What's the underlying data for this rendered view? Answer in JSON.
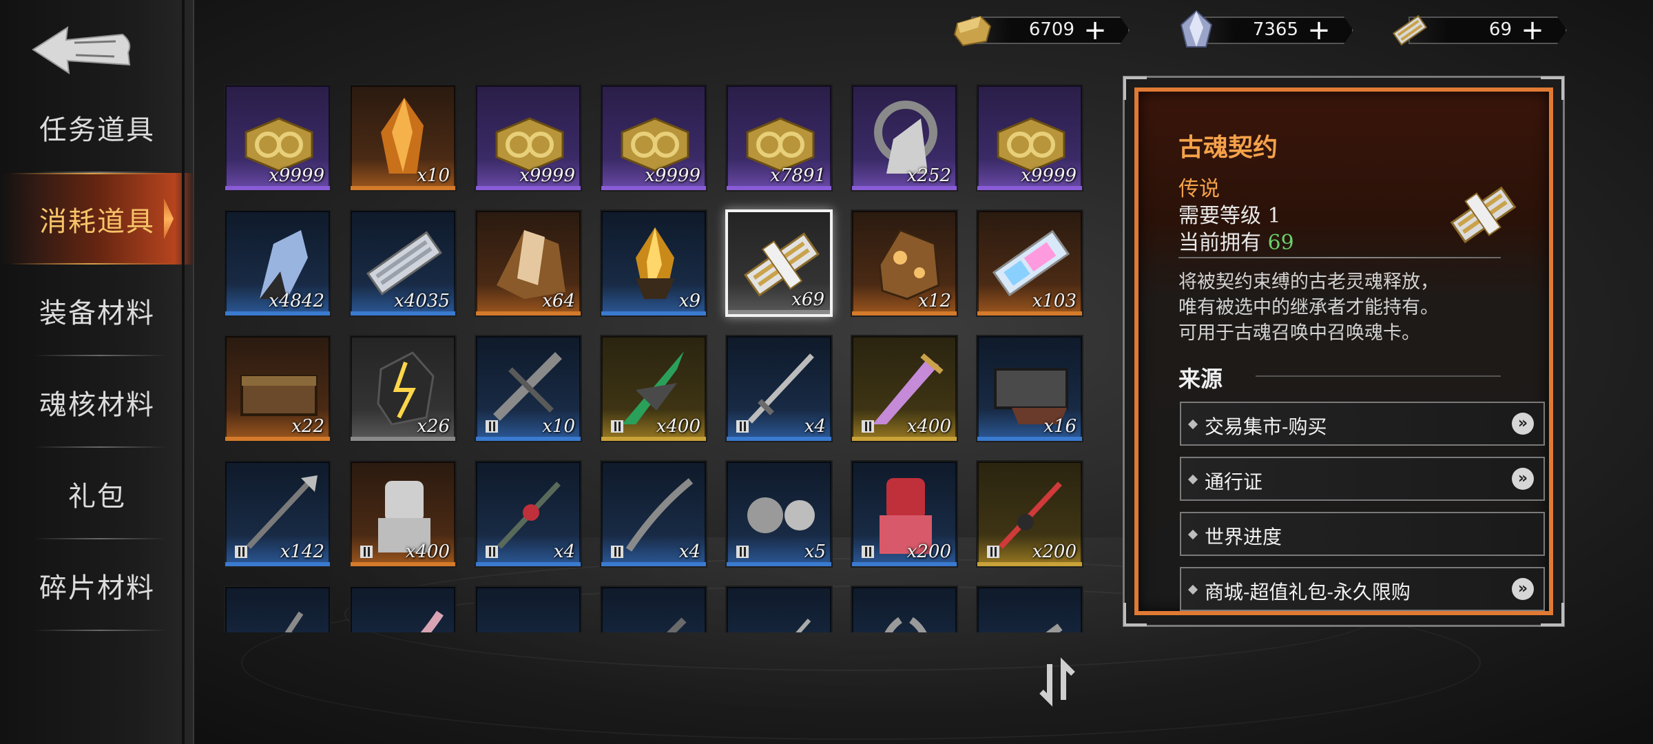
{
  "sidebar": {
    "items": [
      {
        "label": "任务道具",
        "active": false
      },
      {
        "label": "消耗道具",
        "active": true
      },
      {
        "label": "装备材料",
        "active": false
      },
      {
        "label": "魂核材料",
        "active": false
      },
      {
        "label": "礼包",
        "active": false
      },
      {
        "label": "碎片材料",
        "active": false
      }
    ]
  },
  "currency": [
    {
      "icon": "gold-ingot-icon",
      "value": "6709"
    },
    {
      "icon": "crystal-icon",
      "value": "7365"
    },
    {
      "icon": "soul-contract-icon",
      "value": "69"
    }
  ],
  "grid": {
    "rows": [
      [
        {
          "icon": "gold-chest-icon",
          "rarity": "purple",
          "count": "x9999"
        },
        {
          "icon": "amber-shard-icon",
          "rarity": "orange",
          "count": "x10"
        },
        {
          "icon": "gold-chest-icon",
          "rarity": "purple",
          "count": "x9999"
        },
        {
          "icon": "gold-chest-icon",
          "rarity": "purple",
          "count": "x9999"
        },
        {
          "icon": "gold-chest-icon",
          "rarity": "purple",
          "count": "x7891"
        },
        {
          "icon": "silver-ring-icon",
          "rarity": "purple",
          "count": "x252"
        },
        {
          "icon": "gold-chest-icon",
          "rarity": "purple",
          "count": "x9999"
        }
      ],
      [
        {
          "icon": "blue-crystal-icon",
          "rarity": "blue",
          "count": "x4842"
        },
        {
          "icon": "silver-contract-icon",
          "rarity": "blue",
          "count": "x4035"
        },
        {
          "icon": "brown-crystal-icon",
          "rarity": "orange",
          "count": "x64"
        },
        {
          "icon": "gold-crystal-icon",
          "rarity": "blue",
          "count": "x9"
        },
        {
          "icon": "soul-contract-icon",
          "rarity": "gray",
          "count": "x69",
          "selected": true
        },
        {
          "icon": "ore-icon",
          "rarity": "orange",
          "count": "x12"
        },
        {
          "icon": "prism-contract-icon",
          "rarity": "orange",
          "count": "x103"
        }
      ],
      [
        {
          "icon": "chest-icon",
          "rarity": "orange",
          "count": "x22"
        },
        {
          "icon": "lightning-stone-icon",
          "rarity": "gray",
          "count": "x26"
        },
        {
          "icon": "crossbow-icon",
          "rarity": "blue",
          "count": "x10",
          "locked": true
        },
        {
          "icon": "green-blade-icon",
          "rarity": "gold",
          "count": "x400",
          "locked": true
        },
        {
          "icon": "sword-icon",
          "rarity": "blue",
          "count": "x4",
          "locked": true
        },
        {
          "icon": "greatsword-icon",
          "rarity": "gold",
          "count": "x400",
          "locked": true
        },
        {
          "icon": "mimic-chest-icon",
          "rarity": "blue",
          "count": "x16"
        }
      ],
      [
        {
          "icon": "spear-icon",
          "rarity": "blue",
          "count": "x142",
          "locked": true
        },
        {
          "icon": "armor-icon",
          "rarity": "orange",
          "count": "x400",
          "locked": true
        },
        {
          "icon": "rose-spear-icon",
          "rarity": "blue",
          "count": "x4",
          "locked": true
        },
        {
          "icon": "scythe-icon",
          "rarity": "blue",
          "count": "x4",
          "locked": true
        },
        {
          "icon": "gauntlet-icon",
          "rarity": "blue",
          "count": "x5",
          "locked": true
        },
        {
          "icon": "red-armor-icon",
          "rarity": "blue",
          "count": "x200",
          "locked": true
        },
        {
          "icon": "red-staff-icon",
          "rarity": "gold",
          "count": "x200",
          "locked": true
        }
      ],
      [
        {
          "icon": "axe-icon",
          "rarity": "blue",
          "count": ""
        },
        {
          "icon": "claw-icon",
          "rarity": "blue",
          "count": ""
        },
        {
          "icon": "gold-crown-icon",
          "rarity": "blue",
          "count": ""
        },
        {
          "icon": "blade-icon",
          "rarity": "blue",
          "count": ""
        },
        {
          "icon": "dagger-icon",
          "rarity": "blue",
          "count": ""
        },
        {
          "icon": "horn-icon",
          "rarity": "blue",
          "count": ""
        },
        {
          "icon": "gun-icon",
          "rarity": "blue",
          "count": ""
        }
      ]
    ]
  },
  "detail": {
    "title": "古魂契约",
    "rarity": "传说",
    "level_label": "需要等级",
    "level": "1",
    "own_label": "当前拥有",
    "own": "69",
    "icon": "soul-contract-icon",
    "desc_lines": [
      "将被契约束缚的古老灵魂释放，",
      "唯有被选中的继承者才能持有。",
      "可用于古魂召唤中召唤魂卡。"
    ],
    "source_title": "来源",
    "sources": [
      {
        "label": "交易集市-购买",
        "has_link": true
      },
      {
        "label": "通行证",
        "has_link": true
      },
      {
        "label": "世界进度",
        "has_link": false
      },
      {
        "label": "商城-超值礼包-永久限购",
        "has_link": true
      }
    ]
  },
  "colors": {
    "accent_orange": "#f5a24a",
    "own_green": "#6ad06a",
    "panel_border": "#e07a34"
  }
}
